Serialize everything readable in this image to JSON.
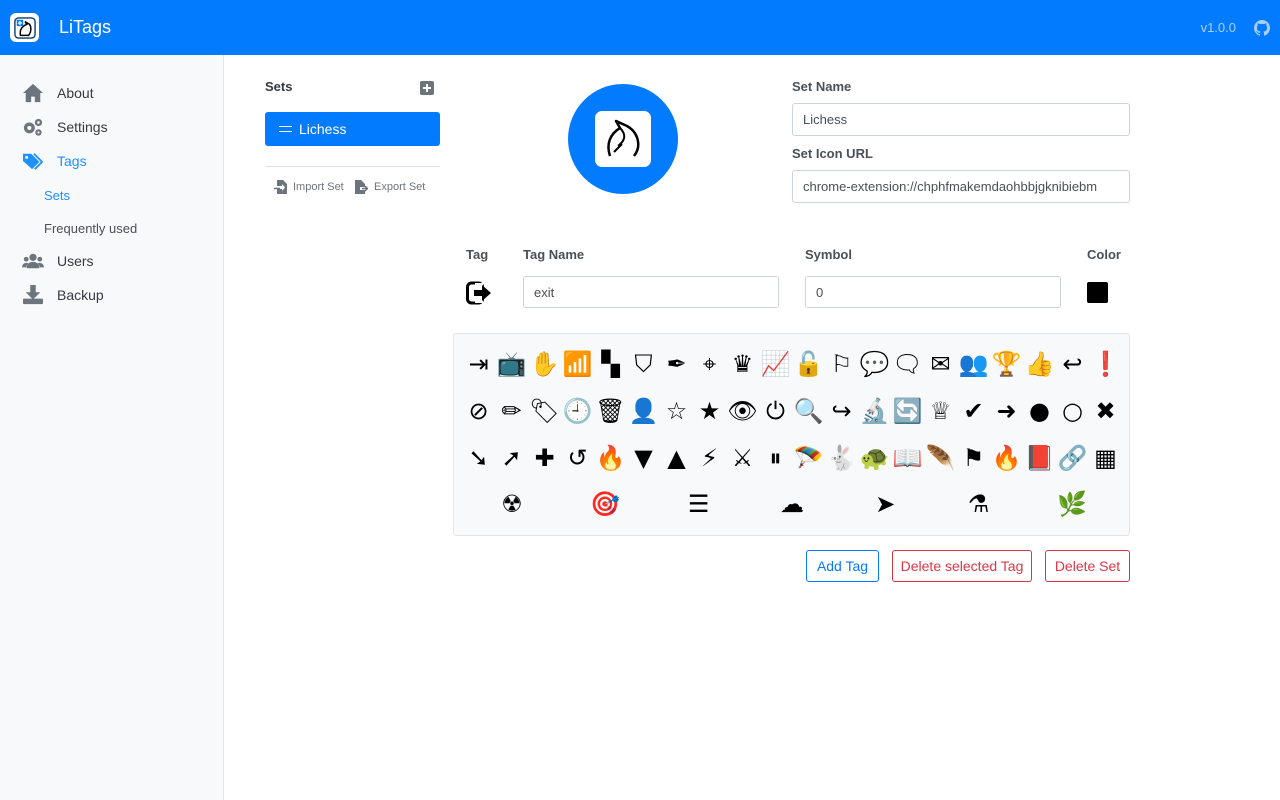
{
  "app": {
    "title": "LiTags",
    "version": "v1.0.0"
  },
  "sidebar": {
    "items": [
      {
        "label": "About",
        "icon": "home-icon"
      },
      {
        "label": "Settings",
        "icon": "gears-icon"
      },
      {
        "label": "Tags",
        "icon": "tags-icon"
      },
      {
        "label": "Users",
        "icon": "users-icon"
      },
      {
        "label": "Backup",
        "icon": "download-icon"
      }
    ],
    "sub_items": [
      {
        "label": "Sets"
      },
      {
        "label": "Frequently used"
      }
    ],
    "active_color": "#1e90ff"
  },
  "sets": {
    "heading": "Sets",
    "items": [
      {
        "label": "Lichess"
      }
    ],
    "import_label": "Import Set",
    "export_label": "Export Set"
  },
  "set_form": {
    "name_label": "Set Name",
    "name_value": "Lichess",
    "icon_url_label": "Set Icon URL",
    "icon_url_value": "chrome-extension://chphfmakemdaohbbjgknibiebm"
  },
  "tag_form": {
    "tag_label": "Tag",
    "name_label": "Tag Name",
    "name_value": "exit",
    "symbol_label": "Symbol",
    "symbol_value": "0",
    "color_label": "Color",
    "color_value": "#000000"
  },
  "icon_rows": [
    [
      "exit-icon",
      "tv-icon",
      "hand-icon",
      "rss-icon",
      "chessboard-icon",
      "shield-icon",
      "quill-icon",
      "crosshair-icon",
      "crown-icon",
      "chart-icon",
      "unlock-icon",
      "flag-outline-icon",
      "chat-icon",
      "chats-icon",
      "envelope-icon",
      "users-icon",
      "trophy-icon",
      "thumbs-up-icon",
      "reply-icon",
      "exclamation-icon"
    ],
    [
      "ban-icon",
      "pencil-icon",
      "tag-icon",
      "clock-icon",
      "trash-icon",
      "user-icon",
      "star-outline-icon",
      "star-icon",
      "eye-icon",
      "power-icon",
      "search-icon",
      "share-icon",
      "microscope-icon",
      "sync-icon",
      "queen-icon",
      "check-icon",
      "sign-in-icon",
      "circle-filled-icon",
      "circle-outline-icon",
      "close-icon"
    ],
    [
      "arrow-down-right-icon",
      "arrow-up-right-icon",
      "plus-square-icon",
      "undo-icon",
      "flame-icon",
      "caret-down-icon",
      "caret-up-icon",
      "lightning-icon",
      "swords-icon",
      "pause-icon",
      "parachute-icon",
      "rabbit-icon",
      "turtle-icon",
      "book-icon",
      "feather-icon",
      "flag-icon",
      "fire-icon",
      "book-closed-icon",
      "link-icon",
      "grid-icon"
    ],
    [
      "nuke-icon",
      "target-icon",
      "layers-icon",
      "cloud-upload-icon",
      "cursor-icon",
      "bong-icon",
      "cannabis-icon"
    ]
  ],
  "icon_glyphs": [
    [
      "⇥",
      "📺",
      "✋",
      "📶",
      "▚",
      "⛉",
      "✒",
      "⌖",
      "♛",
      "📈",
      "🔓",
      "⚐",
      "💬",
      "🗨",
      "✉",
      "👥",
      "🏆",
      "👍",
      "↩",
      "❗"
    ],
    [
      "⊘",
      "✏",
      "🏷",
      "🕘",
      "🗑",
      "👤",
      "☆",
      "★",
      "👁",
      "⏻",
      "🔍",
      "↪",
      "🔬",
      "🔄",
      "♕",
      "✔",
      "➜",
      "●",
      "○",
      "✖"
    ],
    [
      "➘",
      "➚",
      "✚",
      "↺",
      "🔥",
      "▼",
      "▲",
      "⚡",
      "⚔",
      "⏸",
      "🪂",
      "🐇",
      "🐢",
      "📖",
      "🪶",
      "⚑",
      "🔥",
      "📕",
      "🔗",
      "▦"
    ],
    [
      "☢",
      "🎯",
      "☰",
      "☁",
      "➤",
      "⚗",
      "🌿"
    ]
  ],
  "buttons": {
    "add_tag": "Add Tag",
    "delete_tag": "Delete selected Tag",
    "delete_set": "Delete Set"
  },
  "colors": {
    "brand": "#037bff",
    "danger": "#dc3545"
  }
}
